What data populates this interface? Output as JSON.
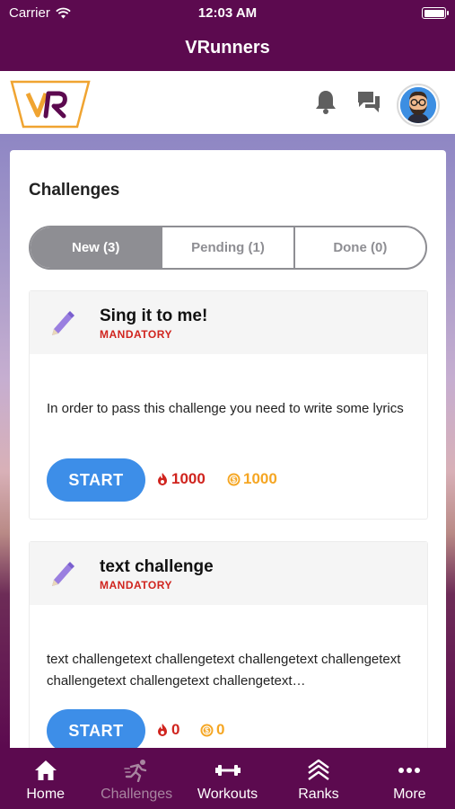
{
  "status": {
    "carrier": "Carrier",
    "time": "12:03 AM"
  },
  "app": {
    "title": "VRunners",
    "logo_text": "VR"
  },
  "header": {
    "icons": [
      "bell-icon",
      "chat-icon",
      "avatar"
    ]
  },
  "challenges": {
    "title": "Challenges",
    "tabs": [
      {
        "label": "New (3)",
        "active": true
      },
      {
        "label": "Pending (1)",
        "active": false
      },
      {
        "label": "Done (0)",
        "active": false
      }
    ],
    "cards": [
      {
        "title": "Sing it to me!",
        "tag": "MANDATORY",
        "description": "In order to pass this challenge you need to write some lyrics",
        "button": "START",
        "fire": "1000",
        "coins": "1000"
      },
      {
        "title": "text challenge",
        "tag": "MANDATORY",
        "description": "text challengetext challengetext challengetext challengetext challengetext challengetext challengetext…",
        "button": "START",
        "fire": "0",
        "coins": "0"
      }
    ]
  },
  "tabbar": [
    {
      "label": "Home",
      "icon": "home-icon"
    },
    {
      "label": "Challenges",
      "icon": "runner-icon"
    },
    {
      "label": "Workouts",
      "icon": "dumbbell-icon"
    },
    {
      "label": "Ranks",
      "icon": "ranks-icon"
    },
    {
      "label": "More",
      "icon": "more-icon"
    }
  ],
  "colors": {
    "brand": "#5c0a4f",
    "accent": "#3d8ee8",
    "danger": "#d0241e",
    "coin": "#f5a623"
  }
}
